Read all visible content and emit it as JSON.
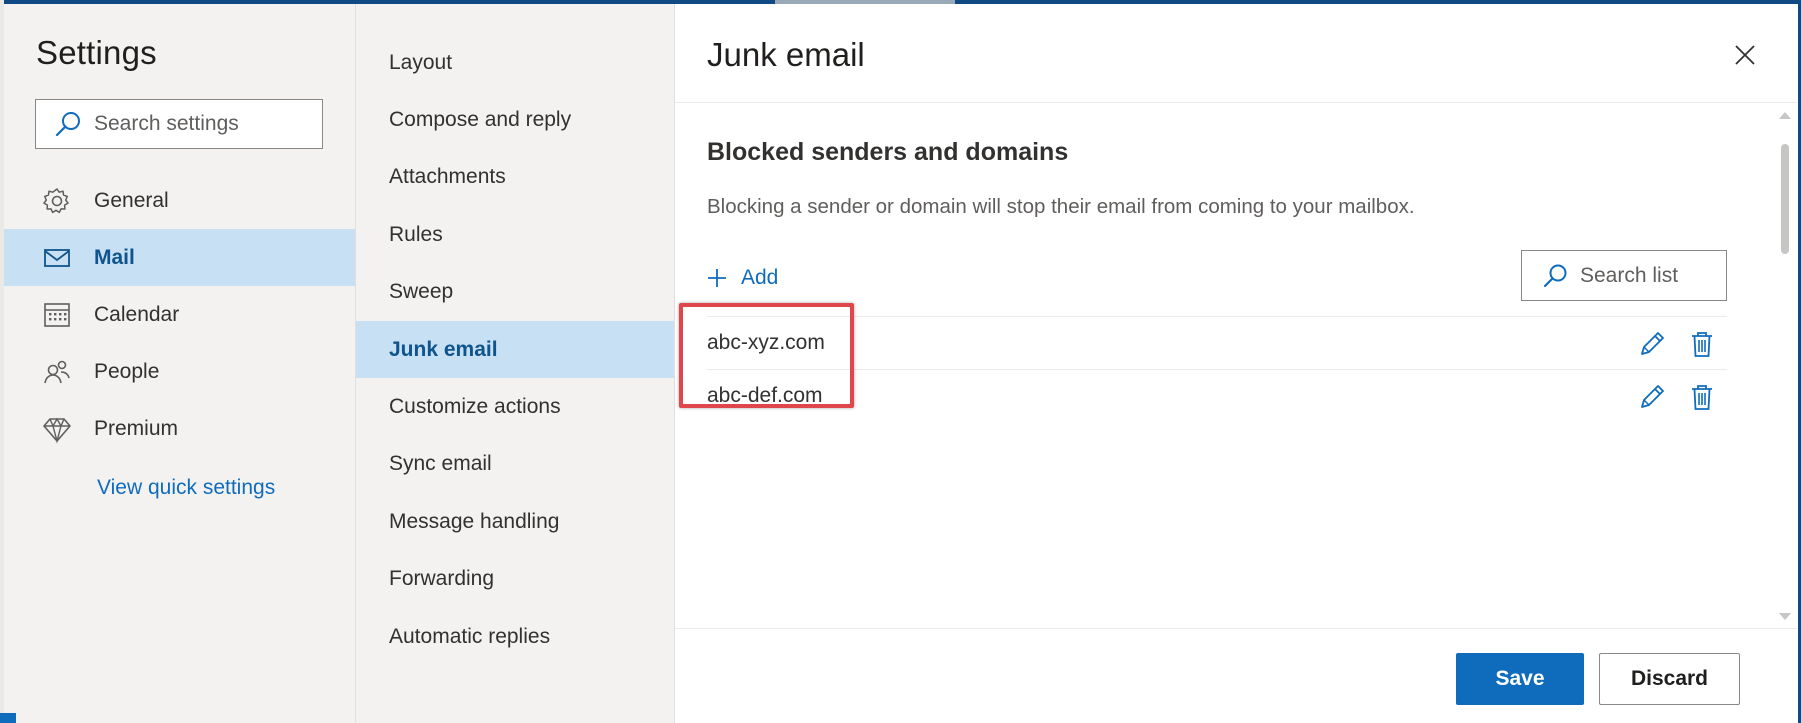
{
  "colors": {
    "accent": "#0f6cbd",
    "selected_bg": "#c7e0f4",
    "pane_bg": "#f3f2f1",
    "highlight_border": "#e0474c"
  },
  "settings": {
    "title": "Settings",
    "search_placeholder": "Search settings",
    "search_icon": "search-icon",
    "nav_items": [
      {
        "label": "General",
        "icon": "gear-icon",
        "selected": false
      },
      {
        "label": "Mail",
        "icon": "mail-icon",
        "selected": true
      },
      {
        "label": "Calendar",
        "icon": "calendar-icon",
        "selected": false
      },
      {
        "label": "People",
        "icon": "people-icon",
        "selected": false
      },
      {
        "label": "Premium",
        "icon": "diamond-icon",
        "selected": false
      }
    ],
    "view_quick_settings": "View quick settings"
  },
  "mail_menu": {
    "items": [
      {
        "label": "Layout",
        "selected": false
      },
      {
        "label": "Compose and reply",
        "selected": false
      },
      {
        "label": "Attachments",
        "selected": false
      },
      {
        "label": "Rules",
        "selected": false
      },
      {
        "label": "Sweep",
        "selected": false
      },
      {
        "label": "Junk email",
        "selected": true
      },
      {
        "label": "Customize actions",
        "selected": false
      },
      {
        "label": "Sync email",
        "selected": false
      },
      {
        "label": "Message handling",
        "selected": false
      },
      {
        "label": "Forwarding",
        "selected": false
      },
      {
        "label": "Automatic replies",
        "selected": false
      }
    ]
  },
  "panel": {
    "title": "Junk email",
    "close_icon": "close-icon",
    "section_heading": "Blocked senders and domains",
    "description": "Blocking a sender or domain will stop their email from coming to your mailbox.",
    "add_label": "Add",
    "search_list_placeholder": "Search list",
    "blocked": [
      {
        "domain": "abc-xyz.com",
        "edit_icon": "pencil-icon",
        "delete_icon": "trash-icon"
      },
      {
        "domain": "abc-def.com",
        "edit_icon": "pencil-icon",
        "delete_icon": "trash-icon"
      }
    ]
  },
  "footer": {
    "save_label": "Save",
    "discard_label": "Discard"
  }
}
